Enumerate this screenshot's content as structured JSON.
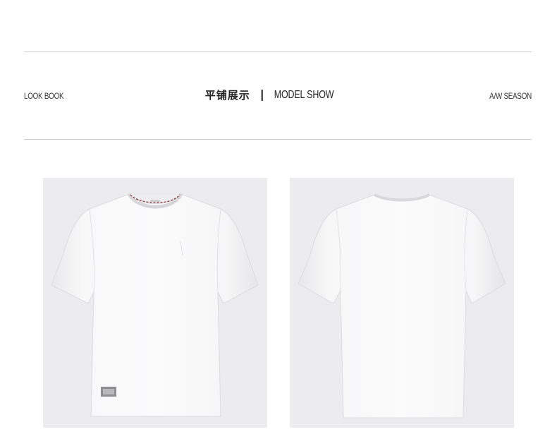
{
  "header": {
    "left_label": "LOOK BOOK",
    "center_cn": "平铺展示",
    "center_en": "MODEL SHOW",
    "right_label": "A/W SEASON"
  },
  "panels": [
    {
      "id": "front",
      "icon": "tshirt-front-image"
    },
    {
      "id": "back",
      "icon": "tshirt-back-image"
    }
  ],
  "colors": {
    "background": "#ffffff",
    "panel_bg": "#ececee",
    "shirt": "#f7f7f8",
    "rule": "#c8c8c8"
  }
}
